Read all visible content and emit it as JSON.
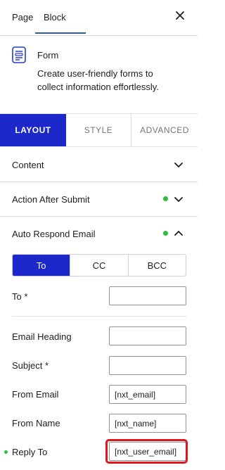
{
  "header": {
    "tabs": [
      {
        "label": "Page"
      },
      {
        "label": "Block"
      }
    ],
    "active_tab": "Block",
    "close_icon": "close-icon"
  },
  "block": {
    "icon": "form-icon",
    "title": "Form",
    "description": "Create user-friendly forms to collect information effortlessly."
  },
  "main_tabs": [
    {
      "label": "LAYOUT",
      "active": true
    },
    {
      "label": "STYLE",
      "active": false
    },
    {
      "label": "ADVANCED",
      "active": false
    }
  ],
  "sections": [
    {
      "title": "Content",
      "expanded": false,
      "has_indicator": false
    },
    {
      "title": "Action After Submit",
      "expanded": false,
      "has_indicator": true
    },
    {
      "title": "Auto Respond Email",
      "expanded": true,
      "has_indicator": true
    }
  ],
  "recipient_tabs": [
    {
      "label": "To",
      "active": true
    },
    {
      "label": "CC",
      "active": false
    },
    {
      "label": "BCC",
      "active": false
    }
  ],
  "fields": {
    "to": {
      "label": "To *",
      "value": ""
    },
    "email_heading": {
      "label": "Email Heading",
      "value": ""
    },
    "subject": {
      "label": "Subject *",
      "value": ""
    },
    "from_email": {
      "label": "From Email",
      "value": "[nxt_email]"
    },
    "from_name": {
      "label": "From Name",
      "value": "[nxt_name]"
    },
    "reply_to": {
      "label": "Reply To",
      "value": "[nxt_user_email]"
    }
  },
  "colors": {
    "accent": "#1c28c9",
    "indicator": "#2bbf3c",
    "highlight": "#e0151f",
    "tab_underline": "#2f5f8a"
  }
}
